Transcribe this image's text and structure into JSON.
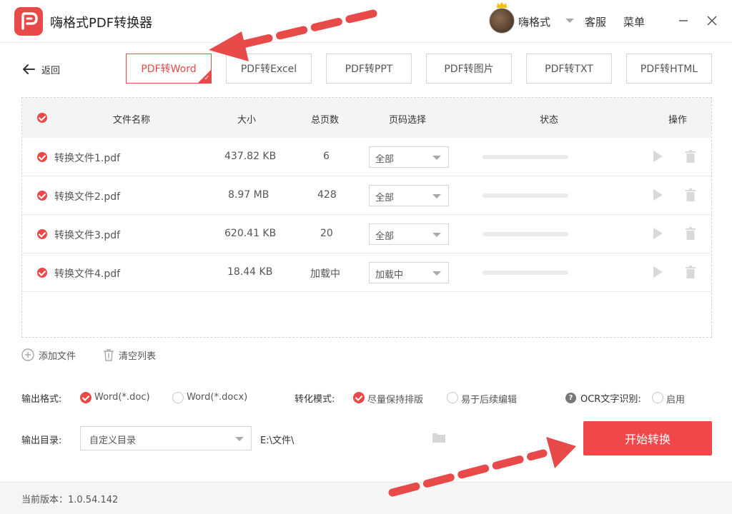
{
  "titlebar": {
    "app_title": "嗨格式PDF转换器",
    "user_name": "嗨格式",
    "service_label": "客服",
    "menu_label": "菜单"
  },
  "nav": {
    "back_label": "返回"
  },
  "tabs": [
    {
      "label": "PDF转Word",
      "active": true
    },
    {
      "label": "PDF转Excel",
      "active": false
    },
    {
      "label": "PDF转PPT",
      "active": false
    },
    {
      "label": "PDF转图片",
      "active": false
    },
    {
      "label": "PDF转TXT",
      "active": false
    },
    {
      "label": "PDF转HTML",
      "active": false
    }
  ],
  "table": {
    "headers": {
      "name": "文件名称",
      "size": "大小",
      "pages": "总页数",
      "range": "页码选择",
      "status": "状态",
      "ops": "操作"
    },
    "rows": [
      {
        "name": "转换文件1.pdf",
        "size": "437.82 KB",
        "pages": "6",
        "range": "全部",
        "progress": 0
      },
      {
        "name": "转换文件2.pdf",
        "size": "8.97 MB",
        "pages": "428",
        "range": "全部",
        "progress": 0
      },
      {
        "name": "转换文件3.pdf",
        "size": "620.41 KB",
        "pages": "20",
        "range": "全部",
        "progress": 0
      },
      {
        "name": "转换文件4.pdf",
        "size": "18.44 KB",
        "pages": "加载中",
        "range": "加载中",
        "progress": 0
      }
    ]
  },
  "actions": {
    "add_file": "添加文件",
    "clear_list": "清空列表"
  },
  "output": {
    "format_label": "输出格式:",
    "format_options": [
      "Word(*.doc)",
      "Word(*.docx)"
    ],
    "format_selected": "Word(*.doc)",
    "mode_label": "转化模式:",
    "mode_options": [
      "尽量保持排版",
      "易于后续编辑"
    ],
    "mode_selected": "尽量保持排版",
    "ocr_label": "OCR文字识别:",
    "ocr_option": "启用",
    "ocr_enabled": false,
    "dir_label": "输出目录:",
    "dir_value": "自定义目录",
    "dir_path": "E:\\文件\\"
  },
  "start_button": "开始转换",
  "footer": {
    "version": "当前版本：1.0.54.142"
  },
  "colors": {
    "accent": "#e84a4a",
    "button": "#f0474a"
  }
}
